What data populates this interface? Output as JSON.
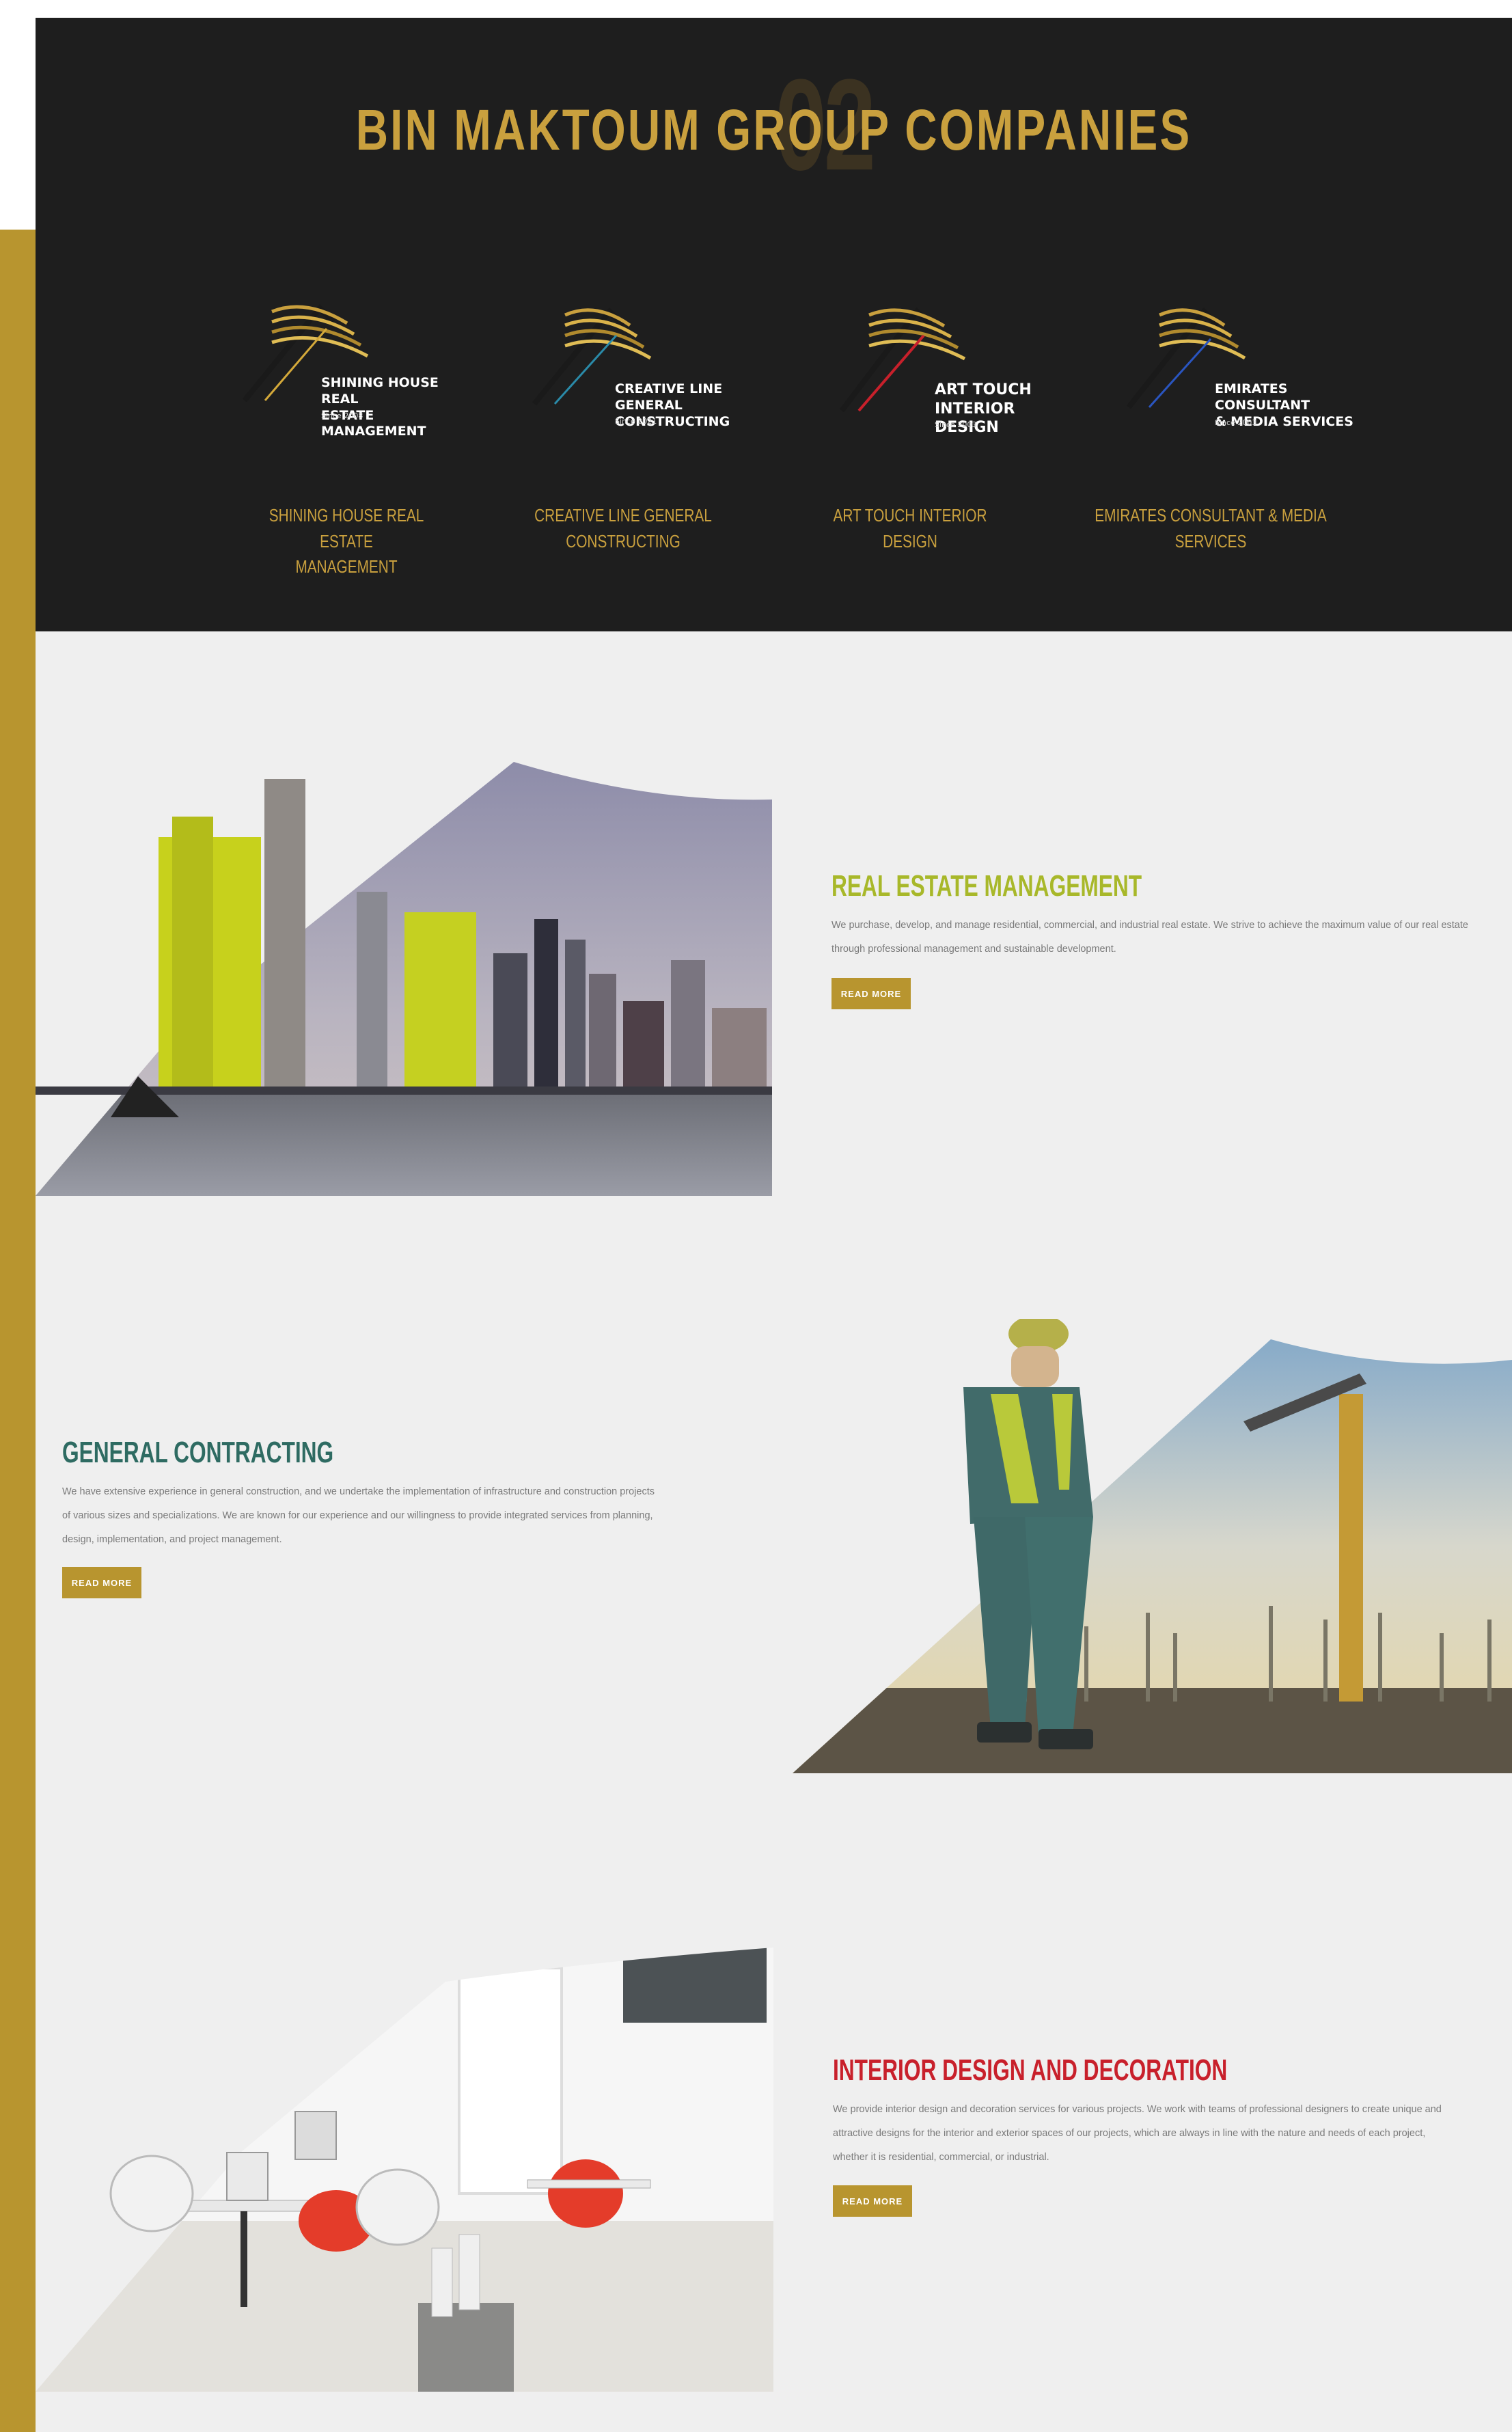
{
  "section": {
    "title": "BIN MAKTOUM GROUP COMPANIES",
    "number": "02"
  },
  "companies": [
    {
      "logo_line1": "SHINING HOUSE REAL",
      "logo_line2": "ESTATE MANAGEMENT",
      "since": "Since 2008",
      "name_line1": "SHINING HOUSE REAL ESTATE",
      "name_line2": "MANAGEMENT",
      "accent": "#d4a93a"
    },
    {
      "logo_line1": "CREATIVE LINE GENERAL",
      "logo_line2": "CONSTRUCTING",
      "since": "Since 2021",
      "name_line1": "CREATIVE LINE GENERAL CONSTRUCTING",
      "name_line2": "",
      "accent": "#2a8aa8"
    },
    {
      "logo_line1": "ART TOUCH",
      "logo_line2": "INTERIOR DESIGN",
      "since": "Since 2003",
      "name_line1": "ART TOUCH INTERIOR DESIGN",
      "name_line2": "",
      "accent": "#c8202b"
    },
    {
      "logo_line1": "EMIRATES CONSULTANT",
      "logo_line2": "& MEDIA SERVICES",
      "since": "Since 2003",
      "name_line1": "EMIRATES CONSULTANT & MEDIA SERVICES",
      "name_line2": "",
      "accent": "#2a55c0"
    }
  ],
  "services": [
    {
      "title": "REAL ESTATE MANAGEMENT",
      "color": "#a8b82a",
      "desc_line1": "We purchase, develop, and manage residential, commercial, and industrial real estate. We strive to achieve the maximum value of our real estate",
      "desc_line2": "through professional management and sustainable development.",
      "desc_line3": "",
      "button": "READ MORE"
    },
    {
      "title": "GENERAL CONTRACTING",
      "color": "#2e6b62",
      "desc_line1": "We have extensive experience in general construction, and we undertake the implementation of infrastructure and construction projects",
      "desc_line2": "of various sizes and specializations. We are known for our experience and our willingness to provide integrated services from planning,",
      "desc_line3": "design, implementation, and project management.",
      "button": "READ MORE"
    },
    {
      "title": "INTERIOR DESIGN AND DECORATION",
      "color": "#c8202b",
      "desc_line1": "We provide interior design and decoration services for various projects. We work with teams of professional designers to create unique and",
      "desc_line2": "attractive designs for the interior and exterior spaces of our projects, which are always in line with the nature and needs of each project,",
      "desc_line3": "whether it is residential, commercial, or industrial.",
      "button": "READ MORE"
    }
  ],
  "colors": {
    "gold": "#b8952f",
    "dark_bg": "#1e1e1e",
    "light_bg": "#efefef"
  }
}
